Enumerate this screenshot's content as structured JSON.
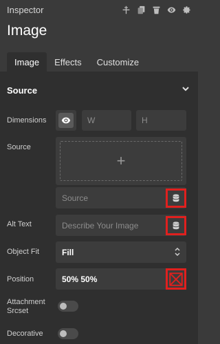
{
  "header": {
    "app_title": "Inspector",
    "icons": [
      "pin-icon",
      "copy-icon",
      "trash-icon",
      "eye-icon",
      "gear-icon"
    ]
  },
  "page_title": "Image",
  "tabs": [
    {
      "label": "Image",
      "active": true
    },
    {
      "label": "Effects",
      "active": false
    },
    {
      "label": "Customize",
      "active": false
    }
  ],
  "section": {
    "title": "Source"
  },
  "rows": {
    "dimensions": {
      "label": "Dimensions",
      "w_placeholder": "W",
      "h_placeholder": "H"
    },
    "source": {
      "label": "Source",
      "plus": "+",
      "source_placeholder": "Source"
    },
    "alt_text": {
      "label": "Alt Text",
      "placeholder": "Describe Your Image"
    },
    "object_fit": {
      "label": "Object Fit",
      "value": "Fill"
    },
    "position": {
      "label": "Position",
      "value": "50% 50%"
    },
    "attachment_srcset": {
      "label_line1": "Attachment",
      "label_line2": "Srcset",
      "enabled": false
    },
    "decorative": {
      "label": "Decorative",
      "enabled": false
    }
  },
  "colors": {
    "background": "#3a3a3a",
    "panel": "#2f2f2f",
    "field": "#3c3c3c",
    "highlight": "#e0201e"
  }
}
